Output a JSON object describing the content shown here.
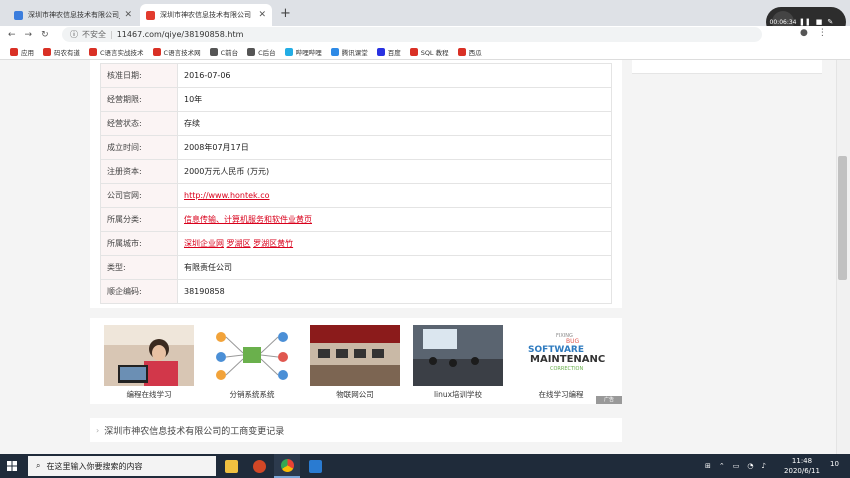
{
  "browser": {
    "tabs": [
      {
        "label": "深圳市神农信息技术有限公司_员",
        "close": "✕"
      },
      {
        "label": "深圳市神农信息技术有限公司",
        "close": "✕"
      }
    ],
    "new_tab": "+",
    "url_security": "不安全",
    "url": "11467.com/qiye/38190858.htm",
    "recorder_time": "00:06:34",
    "bookmarks": [
      {
        "label": "应用",
        "color": "#d93025"
      },
      {
        "label": "码农有道",
        "color": "#d93025"
      },
      {
        "label": "C语言实战技术",
        "color": "#d93025"
      },
      {
        "label": "C语言技术网",
        "color": "#d93025"
      },
      {
        "label": "C前台",
        "color": "#555555"
      },
      {
        "label": "C后台",
        "color": "#555555"
      },
      {
        "label": "哔哩哔哩",
        "color": "#23ade5"
      },
      {
        "label": "腾讯课堂",
        "color": "#2e8ae6"
      },
      {
        "label": "百度",
        "color": "#2932e1"
      },
      {
        "label": "SQL 教程",
        "color": "#d93025"
      },
      {
        "label": "西瓜",
        "color": "#d93025"
      }
    ]
  },
  "info_rows": [
    {
      "key": "核准日期:",
      "value": "2016-07-06"
    },
    {
      "key": "经营期限:",
      "value": "10年"
    },
    {
      "key": "经营状态:",
      "value": "存续"
    },
    {
      "key": "成立时间:",
      "value": "2008年07月17日"
    },
    {
      "key": "注册资本:",
      "value": "2000万元人民币 (万元)"
    },
    {
      "key": "公司官网:",
      "value": "http://www.hontek.co"
    },
    {
      "key": "所属分类:",
      "value": "信息传输、计算机服务和软件业黄页"
    },
    {
      "key": "所属城市:",
      "links": [
        "深圳企业网",
        "罗湖区",
        "罗湖区黄竹"
      ]
    },
    {
      "key": "类型:",
      "value": "有限责任公司"
    },
    {
      "key": "顺企编码:",
      "value": "38190858"
    }
  ],
  "thumbs": [
    {
      "caption": "编程在线学习"
    },
    {
      "caption": "分销系统系统"
    },
    {
      "caption": "物联网公司"
    },
    {
      "caption": "linux培训学校"
    },
    {
      "caption": "在线学习编程"
    }
  ],
  "ad_tag": "广告",
  "changes_title": "深圳市神农信息技术有限公司的工商变更记录",
  "taskbar": {
    "search_placeholder": "在这里输入你要搜索的内容",
    "time": "11:48",
    "date": "2020/6/11",
    "notifications": "10"
  }
}
